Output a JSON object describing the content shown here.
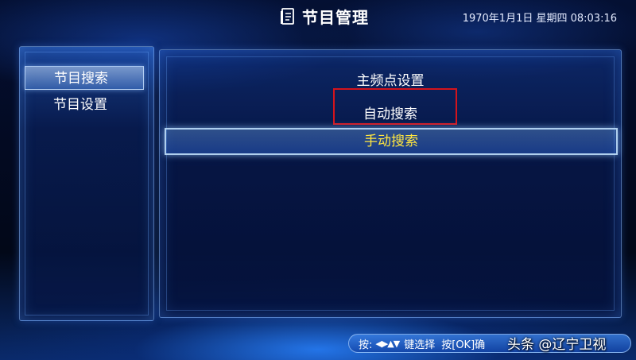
{
  "header": {
    "title": "节目管理",
    "datetime": "1970年1月1日 星期四 08:03:16",
    "title_icon": "document-icon"
  },
  "sidebar": {
    "items": [
      {
        "label": "节目搜索",
        "active": true
      },
      {
        "label": "节目设置",
        "active": false
      }
    ]
  },
  "menu": {
    "items": [
      {
        "label": "主频点设置",
        "selected": false
      },
      {
        "label": "自动搜索",
        "selected": false,
        "highlighted": true
      },
      {
        "label": "手动搜索",
        "selected": true
      }
    ]
  },
  "help_bar": {
    "press_label": "按:",
    "arrow_glyphs": "◀▶▲▼",
    "select_text": "键选择",
    "confirm_text": "按[OK]确"
  },
  "watermark": {
    "text": "头条 @辽宁卫视"
  },
  "colors": {
    "selected_text": "#ffe640",
    "highlight_border": "#d4141c",
    "panel_border": "#8cbeff"
  }
}
